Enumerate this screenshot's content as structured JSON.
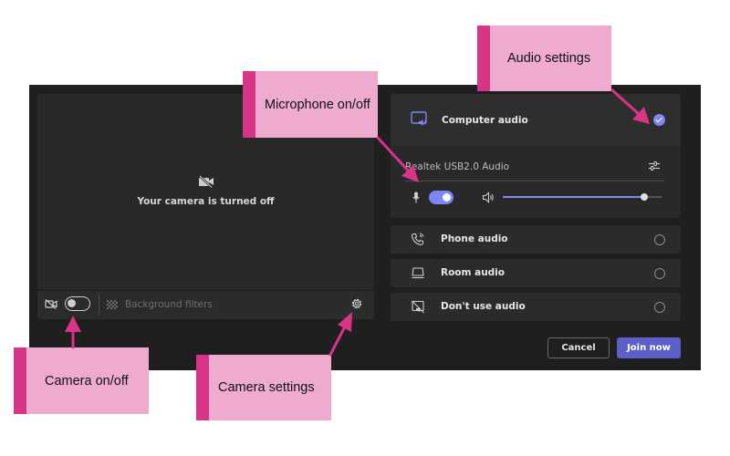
{
  "camera": {
    "status_text": "Your camera is turned off",
    "camera_enabled": false,
    "background_filters_label": "Background filters"
  },
  "audio": {
    "options": [
      {
        "label": "Computer audio",
        "icon": "computer-audio-icon",
        "selected": true
      },
      {
        "label": "Phone audio",
        "icon": "phone-audio-icon",
        "selected": false
      },
      {
        "label": "Room audio",
        "icon": "room-audio-icon",
        "selected": false
      },
      {
        "label": "Don't use audio",
        "icon": "no-audio-icon",
        "selected": false
      }
    ],
    "device_name": "Realtek USB2.0 Audio",
    "mic_enabled": true,
    "volume_level": 0.89
  },
  "buttons": {
    "cancel_label": "Cancel",
    "join_label": "Join now"
  },
  "callouts": {
    "audio_settings": "Audio settings",
    "microphone": "Microphone on/off",
    "camera_toggle": "Camera on/off",
    "camera_settings": "Camera settings"
  },
  "colors": {
    "accent": "#7f85f5",
    "join_button": "#5b5fc7",
    "panel_background": "#1f1f1f",
    "callout_fill": "#eeaacf",
    "callout_bar": "#d83488",
    "arrow": "#d83488"
  }
}
